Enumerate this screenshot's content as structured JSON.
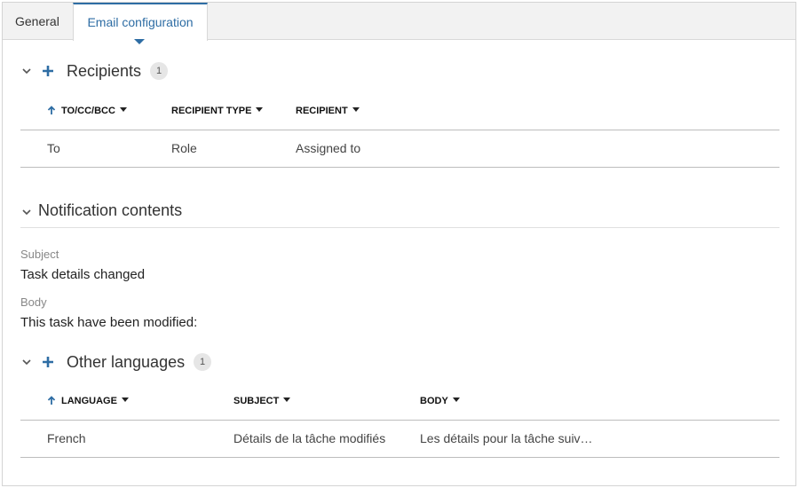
{
  "tabs": {
    "general": "General",
    "email_configuration": "Email configuration"
  },
  "recipients": {
    "title": "Recipients",
    "count": "1",
    "columns": {
      "to_cc_bcc": "TO/CC/BCC",
      "recipient_type": "RECIPIENT TYPE",
      "recipient": "RECIPIENT"
    },
    "rows": [
      {
        "to_cc_bcc": "To",
        "recipient_type": "Role",
        "recipient": "Assigned to"
      }
    ]
  },
  "notification": {
    "title": "Notification contents",
    "subject_label": "Subject",
    "subject_value": "Task details changed",
    "body_label": "Body",
    "body_value": "This task have been modified:"
  },
  "other_languages": {
    "title": "Other languages",
    "count": "1",
    "columns": {
      "language": "LANGUAGE",
      "subject": "SUBJECT",
      "body": "BODY"
    },
    "rows": [
      {
        "language": "French",
        "subject": "Détails de la tâche modifiés",
        "body": "Les détails pour la tâche suiv…"
      }
    ]
  },
  "colors": {
    "accent": "#2e6da4",
    "border": "#bdbdbd"
  },
  "icons": {
    "collapse": "chevron-down-icon",
    "add": "plus-icon",
    "sort": "arrow-up-icon",
    "dropdown": "caret-down-icon"
  }
}
